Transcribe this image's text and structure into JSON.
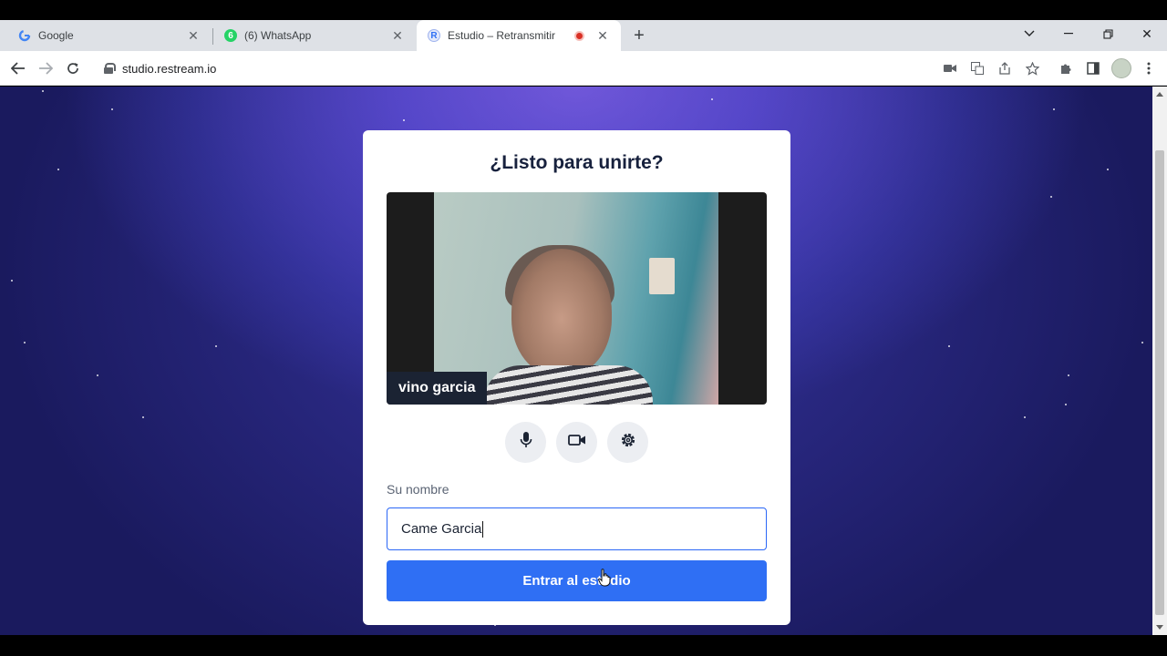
{
  "browser": {
    "tabs": [
      {
        "title": "Google",
        "favicon": "google-g-icon"
      },
      {
        "title": "(6) WhatsApp",
        "favicon": "whatsapp-icon",
        "badge": "6"
      },
      {
        "title": "Estudio – Retransmitir",
        "favicon": "restream-r-icon",
        "recording": true
      }
    ],
    "url": "studio.restream.io"
  },
  "dialog": {
    "title": "¿Listo para unirte?",
    "participant_name": "vino garcia",
    "name_label": "Su nombre",
    "name_value": "Came Garcia",
    "enter_button": "Entrar al estudio"
  },
  "colors": {
    "accent": "#2f6ff4",
    "title_text": "#17213d",
    "background_top": "#8561e0",
    "background_bottom": "#1a1a5e",
    "recording": "#d93025"
  }
}
